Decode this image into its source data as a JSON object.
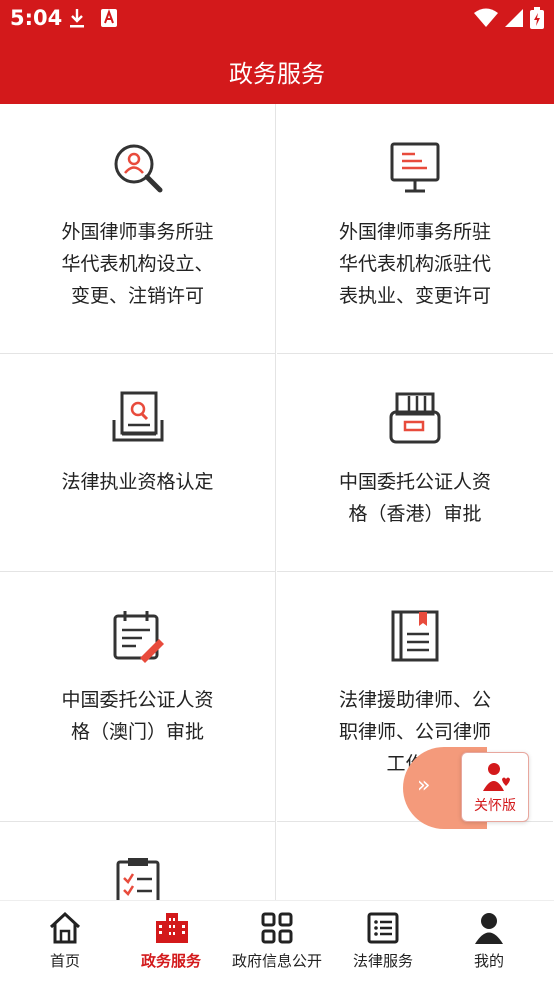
{
  "status_bar": {
    "time": "5:04",
    "icons": [
      "download-icon",
      "app-a-icon",
      "wifi-icon",
      "signal-icon",
      "battery-icon"
    ]
  },
  "header": {
    "title": "政务服务"
  },
  "services": [
    {
      "lines": [
        "外国律师事务所驻",
        "华代表机构设立、",
        "变更、注销许可"
      ],
      "icon": "search-person-icon"
    },
    {
      "lines": [
        "外国律师事务所驻",
        "华代表机构派驻代",
        "表执业、变更许可"
      ],
      "icon": "monitor-icon"
    },
    {
      "lines": [
        "法律执业资格认定"
      ],
      "icon": "document-search-icon"
    },
    {
      "lines": [
        "中国委托公证人资",
        "格（香港）审批"
      ],
      "icon": "printer-icon"
    },
    {
      "lines": [
        "中国委托公证人资",
        "格（澳门）审批"
      ],
      "icon": "calendar-pen-icon"
    },
    {
      "lines": [
        "法律援助律师、公",
        "职律师、公司律师",
        "工作证"
      ],
      "icon": "book-icon"
    },
    {
      "lines": [],
      "icon": "checklist-icon"
    }
  ],
  "floating": {
    "expand_symbol": "»",
    "care_label": "关怀版"
  },
  "bottom_nav": [
    {
      "label": "首页",
      "icon": "home-icon",
      "active": false
    },
    {
      "label": "政务服务",
      "icon": "building-icon",
      "active": true
    },
    {
      "label": "政府信息公开",
      "icon": "grid-icon",
      "active": false
    },
    {
      "label": "法律服务",
      "icon": "list-icon",
      "active": false
    },
    {
      "label": "我的",
      "icon": "person-icon",
      "active": false
    }
  ],
  "colors": {
    "brand_red": "#d3191b",
    "accent_orange": "#f49a7b",
    "icon_dark": "#333333"
  }
}
